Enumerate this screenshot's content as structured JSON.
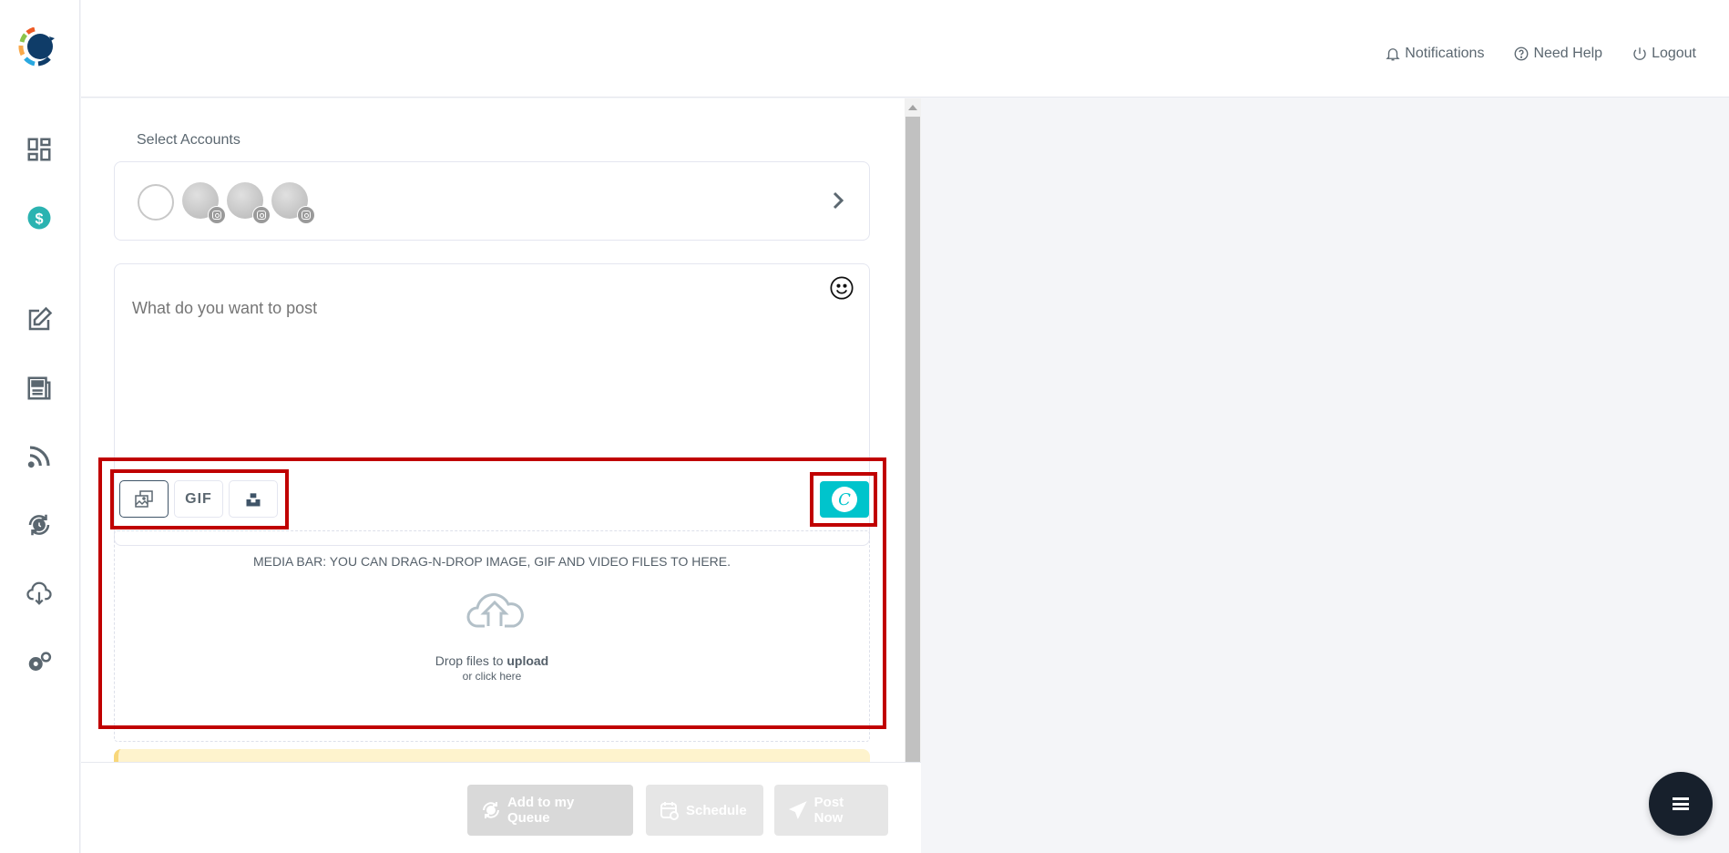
{
  "header": {
    "links": [
      {
        "label": "Notifications",
        "icon": "bell-icon"
      },
      {
        "label": "Need Help",
        "icon": "help-circle-icon"
      },
      {
        "label": "Logout",
        "icon": "power-icon"
      }
    ]
  },
  "sidebar": {
    "items": [
      {
        "name": "dashboard",
        "icon": "dashboard-grid-icon"
      },
      {
        "name": "billing",
        "icon": "dollar-badge-icon"
      },
      {
        "name": "compose",
        "icon": "edit-icon"
      },
      {
        "name": "posts",
        "icon": "newspaper-icon"
      },
      {
        "name": "rss",
        "icon": "rss-icon"
      },
      {
        "name": "queue",
        "icon": "recurring-clock-icon"
      },
      {
        "name": "import",
        "icon": "cloud-download-icon"
      },
      {
        "name": "settings",
        "icon": "gears-icon"
      }
    ]
  },
  "composer": {
    "accounts_label": "Select Accounts",
    "accounts": [
      {
        "network": "instagram"
      },
      {
        "network": "instagram"
      },
      {
        "network": "instagram"
      }
    ],
    "post_placeholder": "What do you want to post",
    "media_buttons": [
      {
        "name": "image",
        "label": ""
      },
      {
        "name": "gif",
        "label": "GIF"
      },
      {
        "name": "unsplash",
        "label": ""
      }
    ],
    "canva_label": "C",
    "dropzone": {
      "title": "MEDIA BAR: YOU CAN DRAG-N-DROP IMAGE, GIF AND VIDEO FILES TO HERE.",
      "text_prefix": "Drop files to ",
      "text_bold": "upload",
      "subtext": "or click here"
    }
  },
  "actions": {
    "queue_label": "Add to my Queue",
    "schedule_label": "Schedule",
    "post_now_label": "Post Now"
  },
  "colors": {
    "accent": "#00c4cc",
    "highlight": "#c00000",
    "fab": "#17202c",
    "billing": "#2bb3b1"
  }
}
